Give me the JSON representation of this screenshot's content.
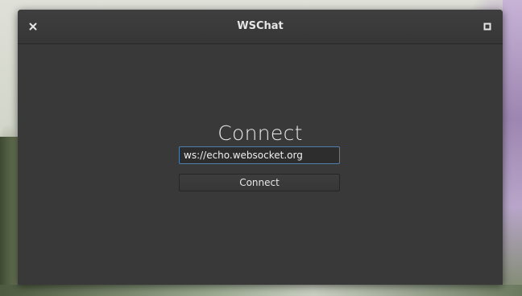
{
  "window": {
    "title": "WSChat"
  },
  "titlebar": {
    "close_icon": "close-icon",
    "maximize_icon": "maximize-icon"
  },
  "main": {
    "heading": "Connect",
    "url_input_value": "ws://echo.websocket.org",
    "connect_button_label": "Connect"
  },
  "colors": {
    "window_bg": "#393939",
    "input_focus_border": "#4f7fae",
    "text": "#e6e6e6"
  }
}
